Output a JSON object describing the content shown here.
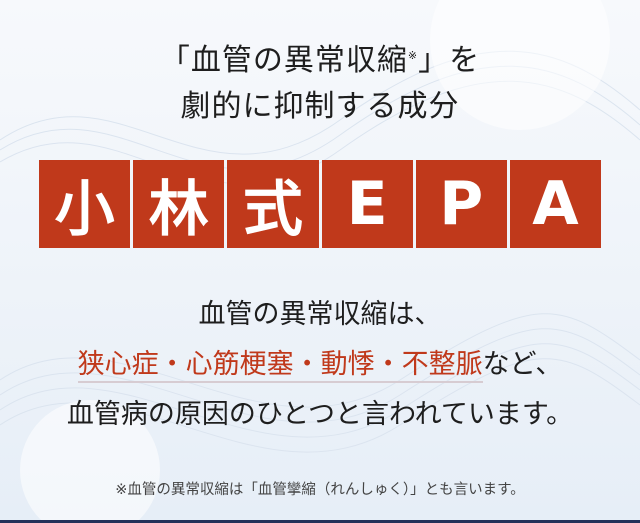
{
  "headline": {
    "line1_before": "「血管の異常収縮",
    "note_mark": "※",
    "line1_after": "」を",
    "line2": "劇的に抑制する成分"
  },
  "brand": {
    "tiles": [
      "小",
      "林",
      "式",
      "E",
      "P",
      "A"
    ]
  },
  "body": {
    "line1": "血管の異常収縮は、",
    "line2_accent": "狭心症・心筋梗塞・動悸・不整脈",
    "line2_tail": "など、",
    "line3": "血管病の原因のひとつと言われています。"
  },
  "footnote": "※血管の異常収縮は「血管攣縮（れんしゅく）」とも言います。",
  "colors": {
    "accent": "#c0391b",
    "text": "#1e1e1e",
    "background": "#eef3f9"
  }
}
